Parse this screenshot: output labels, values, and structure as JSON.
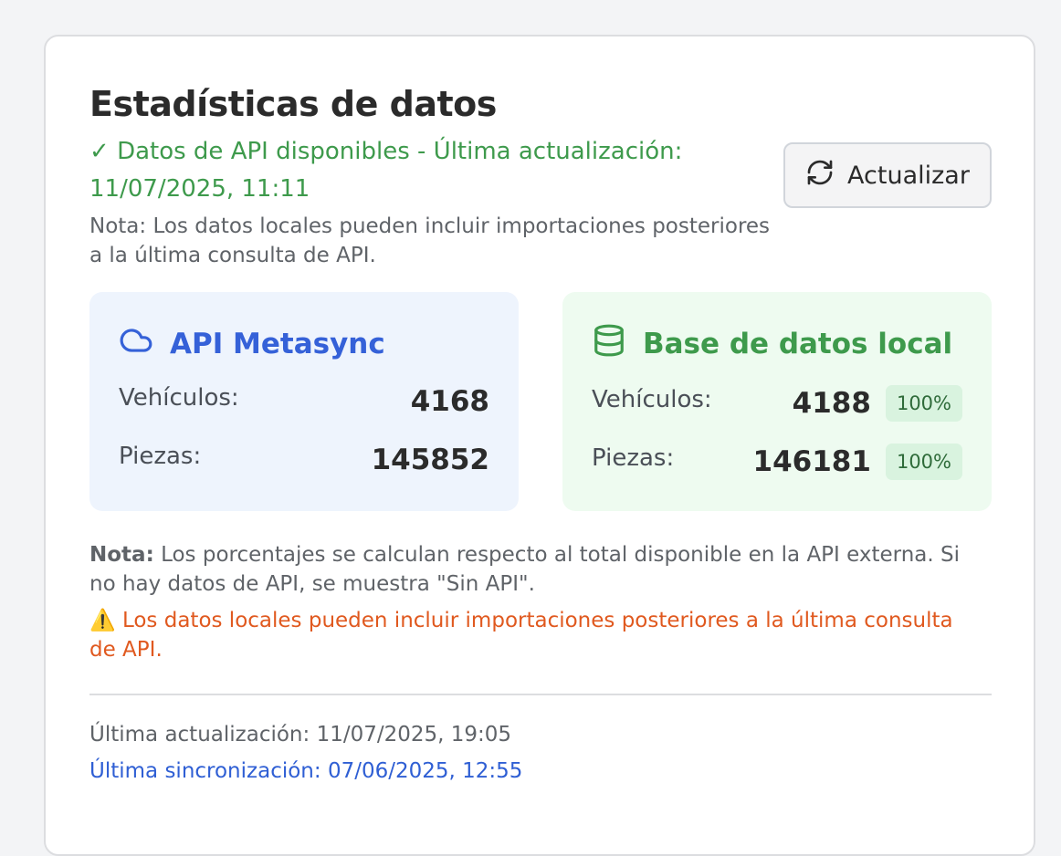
{
  "title": "Estadísticas de datos",
  "api_status": {
    "check": "✓",
    "text": "Datos de API disponibles - Última actualización: 11/07/2025, 11:11"
  },
  "note_top": "Nota: Los datos locales pueden incluir importaciones posteriores a la última consulta de API.",
  "refresh_button": {
    "icon": "refresh-icon",
    "label": "Actualizar"
  },
  "api_panel": {
    "icon": "cloud-icon",
    "title": "API Metasync",
    "rows": [
      {
        "label": "Vehículos:",
        "value": "4168"
      },
      {
        "label": "Piezas:",
        "value": "145852"
      }
    ]
  },
  "local_panel": {
    "icon": "database-icon",
    "title": "Base de datos local",
    "rows": [
      {
        "label": "Vehículos:",
        "value": "4188",
        "percent": "100%"
      },
      {
        "label": "Piezas:",
        "value": "146181",
        "percent": "100%"
      }
    ]
  },
  "note_bottom": {
    "label": "Nota:",
    "text": " Los porcentajes se calculan respecto al total disponible en la API externa. Si no hay datos de API, se muestra \"Sin API\"."
  },
  "warning": {
    "icon": "⚠️",
    "text": " Los datos locales pueden incluir importaciones posteriores a la última consulta de API."
  },
  "footer": {
    "last_update": "Última actualización: 11/07/2025, 19:05",
    "last_sync": "Última sincronización: 07/06/2025, 12:55"
  },
  "colors": {
    "api_blue": "#3561d8",
    "local_green": "#3e9a4c",
    "warning_orange": "#e0591f",
    "sync_link": "#2f5fd4"
  }
}
